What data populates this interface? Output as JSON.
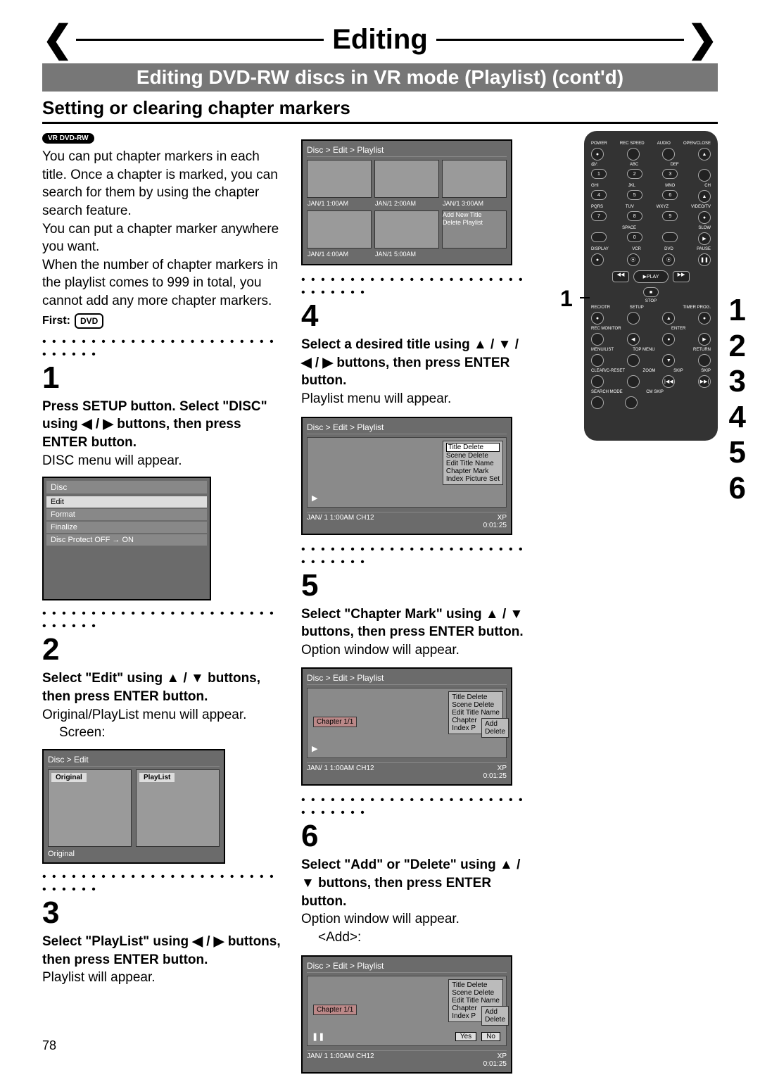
{
  "header": {
    "title": "Editing",
    "subtitle": "Editing DVD-RW discs in VR mode (Playlist) (cont'd)",
    "section": "Setting or clearing chapter markers"
  },
  "badge": {
    "vr_label": "VR",
    "dvd_rw": "DVD-RW"
  },
  "intro": {
    "p1": "You can put chapter markers in each title. Once a chapter is marked, you can search for them by using the chapter search feature.",
    "p2": "You can put a chapter marker anywhere you want.",
    "p3": "When the number of chapter markers in the playlist comes to 999 in total, you cannot add any more chapter markers.",
    "first_label": "First:",
    "dvd_icon": "DVD"
  },
  "steps_left": {
    "s1": {
      "num": "1",
      "bold": "Press SETUP button. Select \"DISC\" using ◀ / ▶ buttons, then press ENTER button.",
      "text": "DISC menu will appear.",
      "menu": {
        "header": "Disc",
        "items": [
          "Edit",
          "Format",
          "Finalize",
          "Disc Protect OFF → ON"
        ]
      }
    },
    "s2": {
      "num": "2",
      "bold": "Select \"Edit\" using ▲ / ▼ buttons, then press ENTER button.",
      "text": "Original/PlayList menu will appear.",
      "screen_label": "Screen:",
      "crumb": "Disc > Edit",
      "tab_original": "Original",
      "tab_playlist": "PlayList",
      "foot": "Original"
    },
    "s3": {
      "num": "3",
      "bold": "Select \"PlayList\" using ◀ / ▶ buttons, then press ENTER button.",
      "text": "Playlist will appear."
    }
  },
  "playlist_grid": {
    "crumb": "Disc > Edit > Playlist",
    "caps": [
      "JAN/1  1:00AM",
      "JAN/1  2:00AM",
      "JAN/1  3:00AM",
      "JAN/1  4:00AM",
      "JAN/1  5:00AM"
    ],
    "add_new": "Add New Title",
    "delete": "Delete Playlist"
  },
  "steps_mid": {
    "s4": {
      "num": "4",
      "bold": "Select a desired title using ▲ / ▼ / ◀ / ▶ buttons, then press ENTER button.",
      "text": "Playlist menu will appear.",
      "crumb": "Disc > Edit > Playlist",
      "menu_item_hi": "Title Delete",
      "menu_items": [
        "Scene Delete",
        "Edit Title Name",
        "Chapter Mark",
        "Index Picture Set"
      ],
      "foot_left": "JAN/ 1   1:00AM  CH12",
      "foot_right": "XP",
      "time": "0:01:25"
    },
    "s5": {
      "num": "5",
      "bold": "Select \"Chapter Mark\" using ▲ / ▼ buttons, then press ENTER button.",
      "text": "Option window will appear.",
      "crumb": "Disc > Edit > Playlist",
      "chapter": "Chapter 1/1",
      "menu_items_top": [
        "Title Delete",
        "Scene Delete",
        "Edit Title Name"
      ],
      "sub_items": [
        "Add",
        "Delete"
      ],
      "menu_items_bottom": [
        "Chapter",
        "Index P"
      ],
      "foot_left": "JAN/ 1   1:00AM  CH12",
      "foot_right": "XP",
      "time": "0:01:25"
    },
    "s6": {
      "num": "6",
      "bold": "Select \"Add\" or \"Delete\" using ▲ / ▼ buttons, then press ENTER button.",
      "text": "Option window will appear.",
      "add_label": "<Add>:",
      "crumb": "Disc > Edit > Playlist",
      "chapter": "Chapter 1/1",
      "menu_items_top": [
        "Title Delete",
        "Scene Delete",
        "Edit Title Name"
      ],
      "sub_items": [
        "Add",
        "Delete"
      ],
      "yes": "Yes",
      "no": "No",
      "foot_left": "JAN/ 1   1:00AM  CH12",
      "foot_right": "XP",
      "time": "0:01:25"
    }
  },
  "remote": {
    "top_labels": [
      "POWER",
      "REC SPEED",
      "AUDIO",
      "OPEN/CLOSE"
    ],
    "num_rows": [
      [
        "1",
        "2",
        "3"
      ],
      [
        "4",
        "5",
        "6"
      ],
      [
        "7",
        "8",
        "9"
      ],
      [
        "",
        "0",
        ""
      ]
    ],
    "num_sub": [
      "@/:",
      "ABC",
      "DEF",
      "GHI",
      "JKL",
      "MNO",
      "PQRS",
      "TUV",
      "WXYZ",
      "",
      "SPACE",
      ""
    ],
    "side_col": [
      "",
      "CH",
      "▲",
      "VIDEO/TV",
      "▼",
      "SLOW",
      "",
      "PAUSE"
    ],
    "row_labels_a": [
      "DISPLAY",
      "VCR",
      "DVD",
      "PAUSE"
    ],
    "play": "PLAY",
    "stop": "STOP",
    "row_labels_b": [
      "REC/OTR",
      "SETUP",
      "",
      "TIMER PROG."
    ],
    "row_labels_c": [
      "REC MONITOR",
      "",
      "ENTER",
      ""
    ],
    "row_labels_d": [
      "MENU/LIST",
      "TOP MENU",
      "",
      "RETURN"
    ],
    "row_labels_e": [
      "CLEAR/C-RESET",
      "ZOOM",
      "SKIP",
      "SKIP"
    ],
    "row_labels_f": [
      "SEARCH MODE",
      "CM SKIP",
      "",
      ""
    ]
  },
  "side_nums": [
    "1",
    "2",
    "3",
    "4",
    "5",
    "6"
  ],
  "leader_1": "1",
  "page_number": "78"
}
